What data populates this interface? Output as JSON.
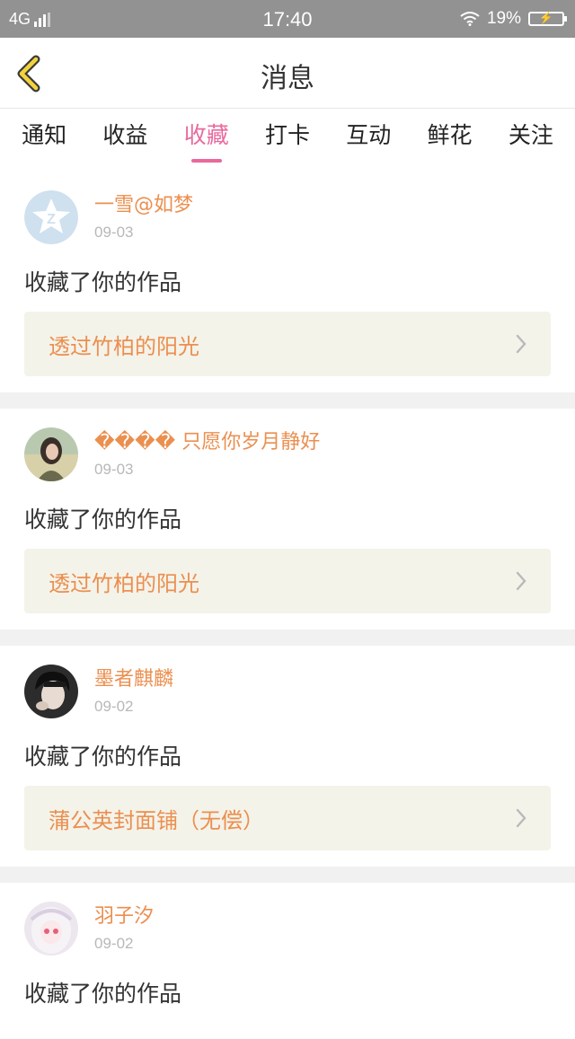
{
  "status_bar": {
    "network": "4G",
    "time": "17:40",
    "battery": "19%"
  },
  "header": {
    "title": "消息"
  },
  "tabs": [
    {
      "label": "通知",
      "active": false
    },
    {
      "label": "收益",
      "active": false
    },
    {
      "label": "收藏",
      "active": true
    },
    {
      "label": "打卡",
      "active": false
    },
    {
      "label": "互动",
      "active": false
    },
    {
      "label": "鲜花",
      "active": false
    },
    {
      "label": "关注",
      "active": false
    }
  ],
  "messages": [
    {
      "user": "一雪@如梦",
      "date": "09-03",
      "action": "收藏了你的作品",
      "work": "透过竹柏的阳光"
    },
    {
      "user": "���� 只愿你岁月静好",
      "date": "09-03",
      "action": "收藏了你的作品",
      "work": "透过竹柏的阳光"
    },
    {
      "user": "墨者麒麟",
      "date": "09-02",
      "action": "收藏了你的作品",
      "work": "蒲公英封面铺（无偿）"
    },
    {
      "user": "羽子汐",
      "date": "09-02",
      "action": "收藏了你的作品"
    }
  ],
  "colors": {
    "accent_pink": "#e86a9d",
    "name_orange": "#eb8f4f",
    "status_bar_gray": "#929292"
  }
}
